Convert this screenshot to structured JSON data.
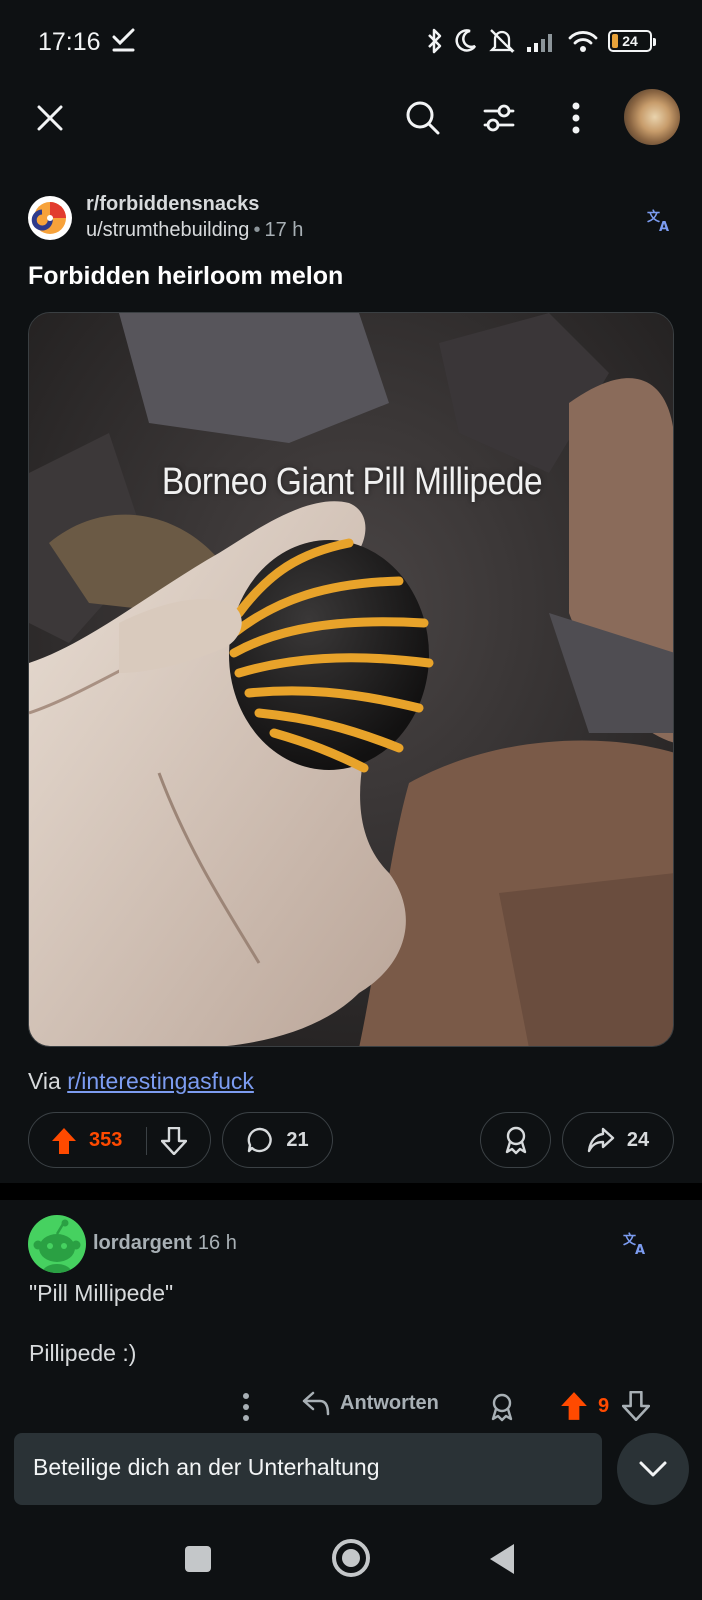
{
  "status_bar": {
    "time": "17:16",
    "battery": "24",
    "icons": [
      "check-icon",
      "bluetooth-icon",
      "moon-icon",
      "mute-icon",
      "signal-icon",
      "wifi-icon",
      "battery-icon"
    ]
  },
  "appbar": {
    "icons": [
      "close-icon",
      "search-icon",
      "filter-icon",
      "more-vertical-icon",
      "avatar"
    ]
  },
  "post": {
    "subreddit": "r/forbiddensnacks",
    "author": "u/strumthebuilding",
    "separator": "•",
    "age": "17 h",
    "title": "Forbidden heirloom melon",
    "media_caption": "Borneo Giant Pill Millipede",
    "via_label": "Via",
    "via_link": "r/interestingasfuck",
    "score": "353",
    "comments": "21",
    "shares": "24"
  },
  "comment": {
    "author": "lordargent",
    "age": "16 h",
    "line1": "\"Pill Millipede\"",
    "line2": "Pillipede :)",
    "reply_label": "Antworten",
    "score": "9"
  },
  "composer": {
    "placeholder": "Beteilige dich an der Unterhaltung"
  },
  "colors": {
    "background": "#0e1113",
    "upvote": "#ff4a00",
    "link": "#7c9cf0",
    "pill_border": "#3b4145",
    "composer_bg": "#2a3236"
  }
}
